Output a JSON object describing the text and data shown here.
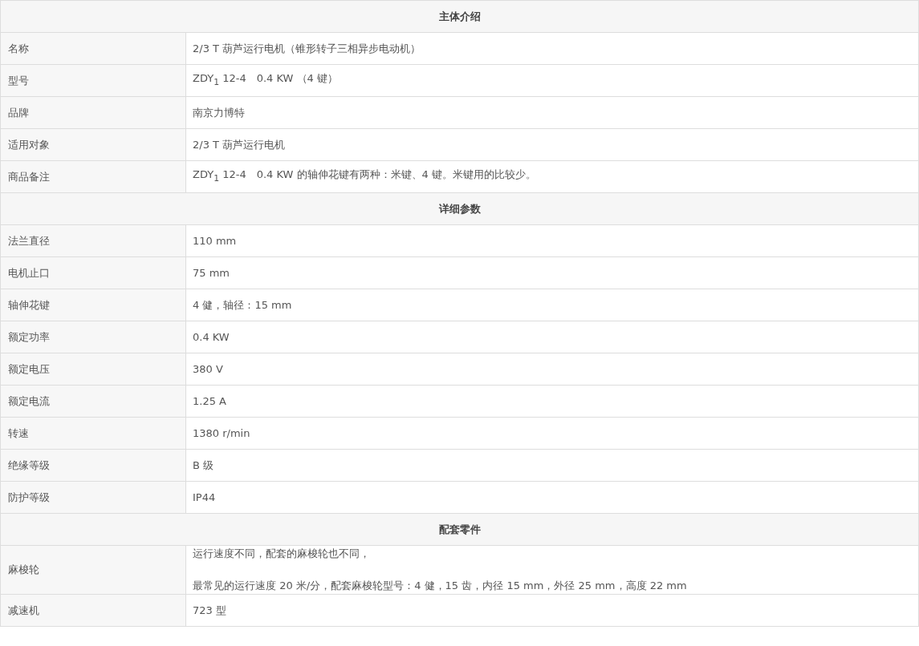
{
  "sections": [
    {
      "title": "主体介绍",
      "rows": [
        {
          "label": "名称",
          "lines": [
            "2/3 T 葫芦运行电机（锥形转子三相异步电动机）"
          ]
        },
        {
          "label": "型号",
          "lines": [
            "ZDY$_{1}$ 12-4　0.4 KW （4 键）"
          ]
        },
        {
          "label": "品牌",
          "lines": [
            "南京力博特"
          ]
        },
        {
          "label": "适用对象",
          "lines": [
            "2/3 T 葫芦运行电机"
          ]
        },
        {
          "label": "商品备注",
          "lines": [
            "ZDY$_{1}$ 12-4　0.4 KW 的轴伸花键有两种：米键、4 键。米键用的比较少。"
          ]
        }
      ]
    },
    {
      "title": "详细参数",
      "rows": [
        {
          "label": "法兰直径",
          "lines": [
            "110 mm"
          ]
        },
        {
          "label": "电机止口",
          "lines": [
            "75 mm"
          ]
        },
        {
          "label": "轴伸花键",
          "lines": [
            "4 健，轴径：15 mm"
          ]
        },
        {
          "label": "额定功率",
          "lines": [
            "0.4 KW"
          ]
        },
        {
          "label": "额定电压",
          "lines": [
            "380 V"
          ]
        },
        {
          "label": "额定电流",
          "lines": [
            "1.25 A"
          ]
        },
        {
          "label": "转速",
          "lines": [
            "1380 r/min"
          ]
        },
        {
          "label": "绝缘等级",
          "lines": [
            "B 级"
          ]
        },
        {
          "label": "防护等级",
          "lines": [
            "IP44"
          ]
        }
      ]
    },
    {
      "title": "配套零件",
      "rows": [
        {
          "label": "麻梭轮",
          "lines": [
            "运行速度不同，配套的麻梭轮也不同，",
            "最常见的运行速度 20 米/分，配套麻梭轮型号：4 健，15 齿，内径 15 mm，外径 25 mm，高度 22 mm"
          ]
        },
        {
          "label": "减速机",
          "lines": [
            "723 型"
          ]
        }
      ]
    }
  ]
}
